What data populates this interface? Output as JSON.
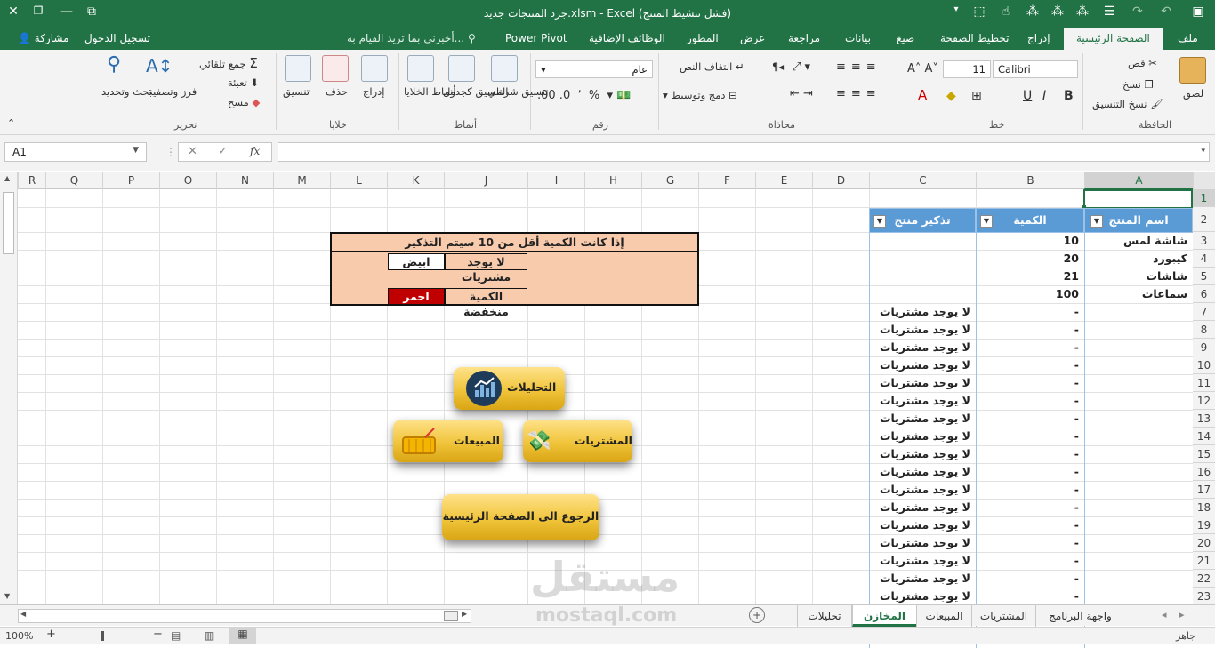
{
  "titlebar": {
    "title": "جرد المنتجات جديد.xlsm - Excel (فشل تنشيط المنتج)",
    "close": "✕",
    "restore": "❐",
    "minimize": "—"
  },
  "tabs": {
    "file": "ملف",
    "home": "الصفحة الرئيسية",
    "insert": "إدراج",
    "page_layout": "تخطيط الصفحة",
    "formulas": "صيغ",
    "data": "بيانات",
    "review": "مراجعة",
    "view": "عرض",
    "developer": "المطور",
    "addins": "الوظائف الإضافية",
    "power_pivot": "Power Pivot",
    "tell_me": "أخبرني بما تريد القيام به...",
    "sign_in": "تسجيل الدخول",
    "share": "مشاركة"
  },
  "ribbon": {
    "paste": "لصق",
    "cut": "قص",
    "copy": "نسخ",
    "format_painter": "نسخ التنسيق",
    "clipboard": "الحافظة",
    "font_name": "Calibri",
    "font_size": "11",
    "font_group": "خط",
    "wrap_text": "التفاف النص",
    "merge_center": "دمج وتوسيط",
    "alignment": "محاذاة",
    "number_format": "عام",
    "number": "رقم",
    "conditional_formatting": "تنسيق شرطي",
    "format_as_table": "التنسيق كجدول",
    "cell_styles": "أنماط الخلايا",
    "styles": "أنماط",
    "insert": "إدراج",
    "delete": "حذف",
    "format": "تنسيق",
    "cells": "خلايا",
    "autosum": "جمع تلقائي",
    "fill": "تعبئة",
    "clear": "مسح",
    "sort_filter": "فرز وتصفية",
    "find_select": "بحث وتحديد",
    "editing": "تحرير"
  },
  "formula_bar": {
    "name_box": "A1",
    "fx": "fx",
    "value": ""
  },
  "columns": [
    "A",
    "B",
    "C",
    "D",
    "E",
    "F",
    "G",
    "H",
    "I",
    "J",
    "K",
    "L",
    "M",
    "N",
    "O",
    "P",
    "Q"
  ],
  "rows": [
    "1",
    "2",
    "3",
    "4",
    "5",
    "6",
    "7",
    "8",
    "9",
    "10",
    "11",
    "12",
    "13",
    "14",
    "15",
    "16",
    "17",
    "18",
    "19",
    "20",
    "21",
    "22",
    "23"
  ],
  "table": {
    "headers": [
      "اسم المنتج",
      "الكمية",
      "تذكير منتج"
    ],
    "products": [
      {
        "name": "شاشة لمس",
        "qty": "10",
        "reminder": ""
      },
      {
        "name": "كيبورد",
        "qty": "20",
        "reminder": ""
      },
      {
        "name": "شاشات",
        "qty": "21",
        "reminder": ""
      },
      {
        "name": "سماعات",
        "qty": "100",
        "reminder": ""
      }
    ],
    "empty_qty": "-",
    "empty_reminder": "لا يوجد مشتريات"
  },
  "note": {
    "title": "إذا كانت الكمية أقل من 10 سيتم التذكير",
    "row1_label": "لا يوجد مشتريات",
    "row1_value": "ابيض",
    "row2_label": "الكمية منخفضة",
    "row2_value": "احمر"
  },
  "buttons": {
    "analytics": "التحليلات",
    "purchases": "المشتريات",
    "sales": "المبيعات",
    "home": "الرجوع الى الصفحة الرئيسية"
  },
  "sheets": [
    "واجهة البرنامج",
    "المشتريات",
    "المبيعات",
    "المخازن",
    "تحليلات"
  ],
  "active_sheet": "المخازن",
  "status": {
    "ready": "جاهز",
    "zoom": "100%"
  },
  "watermark": {
    "text": "مستقل",
    "url": "mostaql.com"
  },
  "colors": {
    "excel_green": "#217346",
    "table_header": "#5b9bd5",
    "note_bg": "#f8cbad",
    "low_red": "#c00000"
  }
}
